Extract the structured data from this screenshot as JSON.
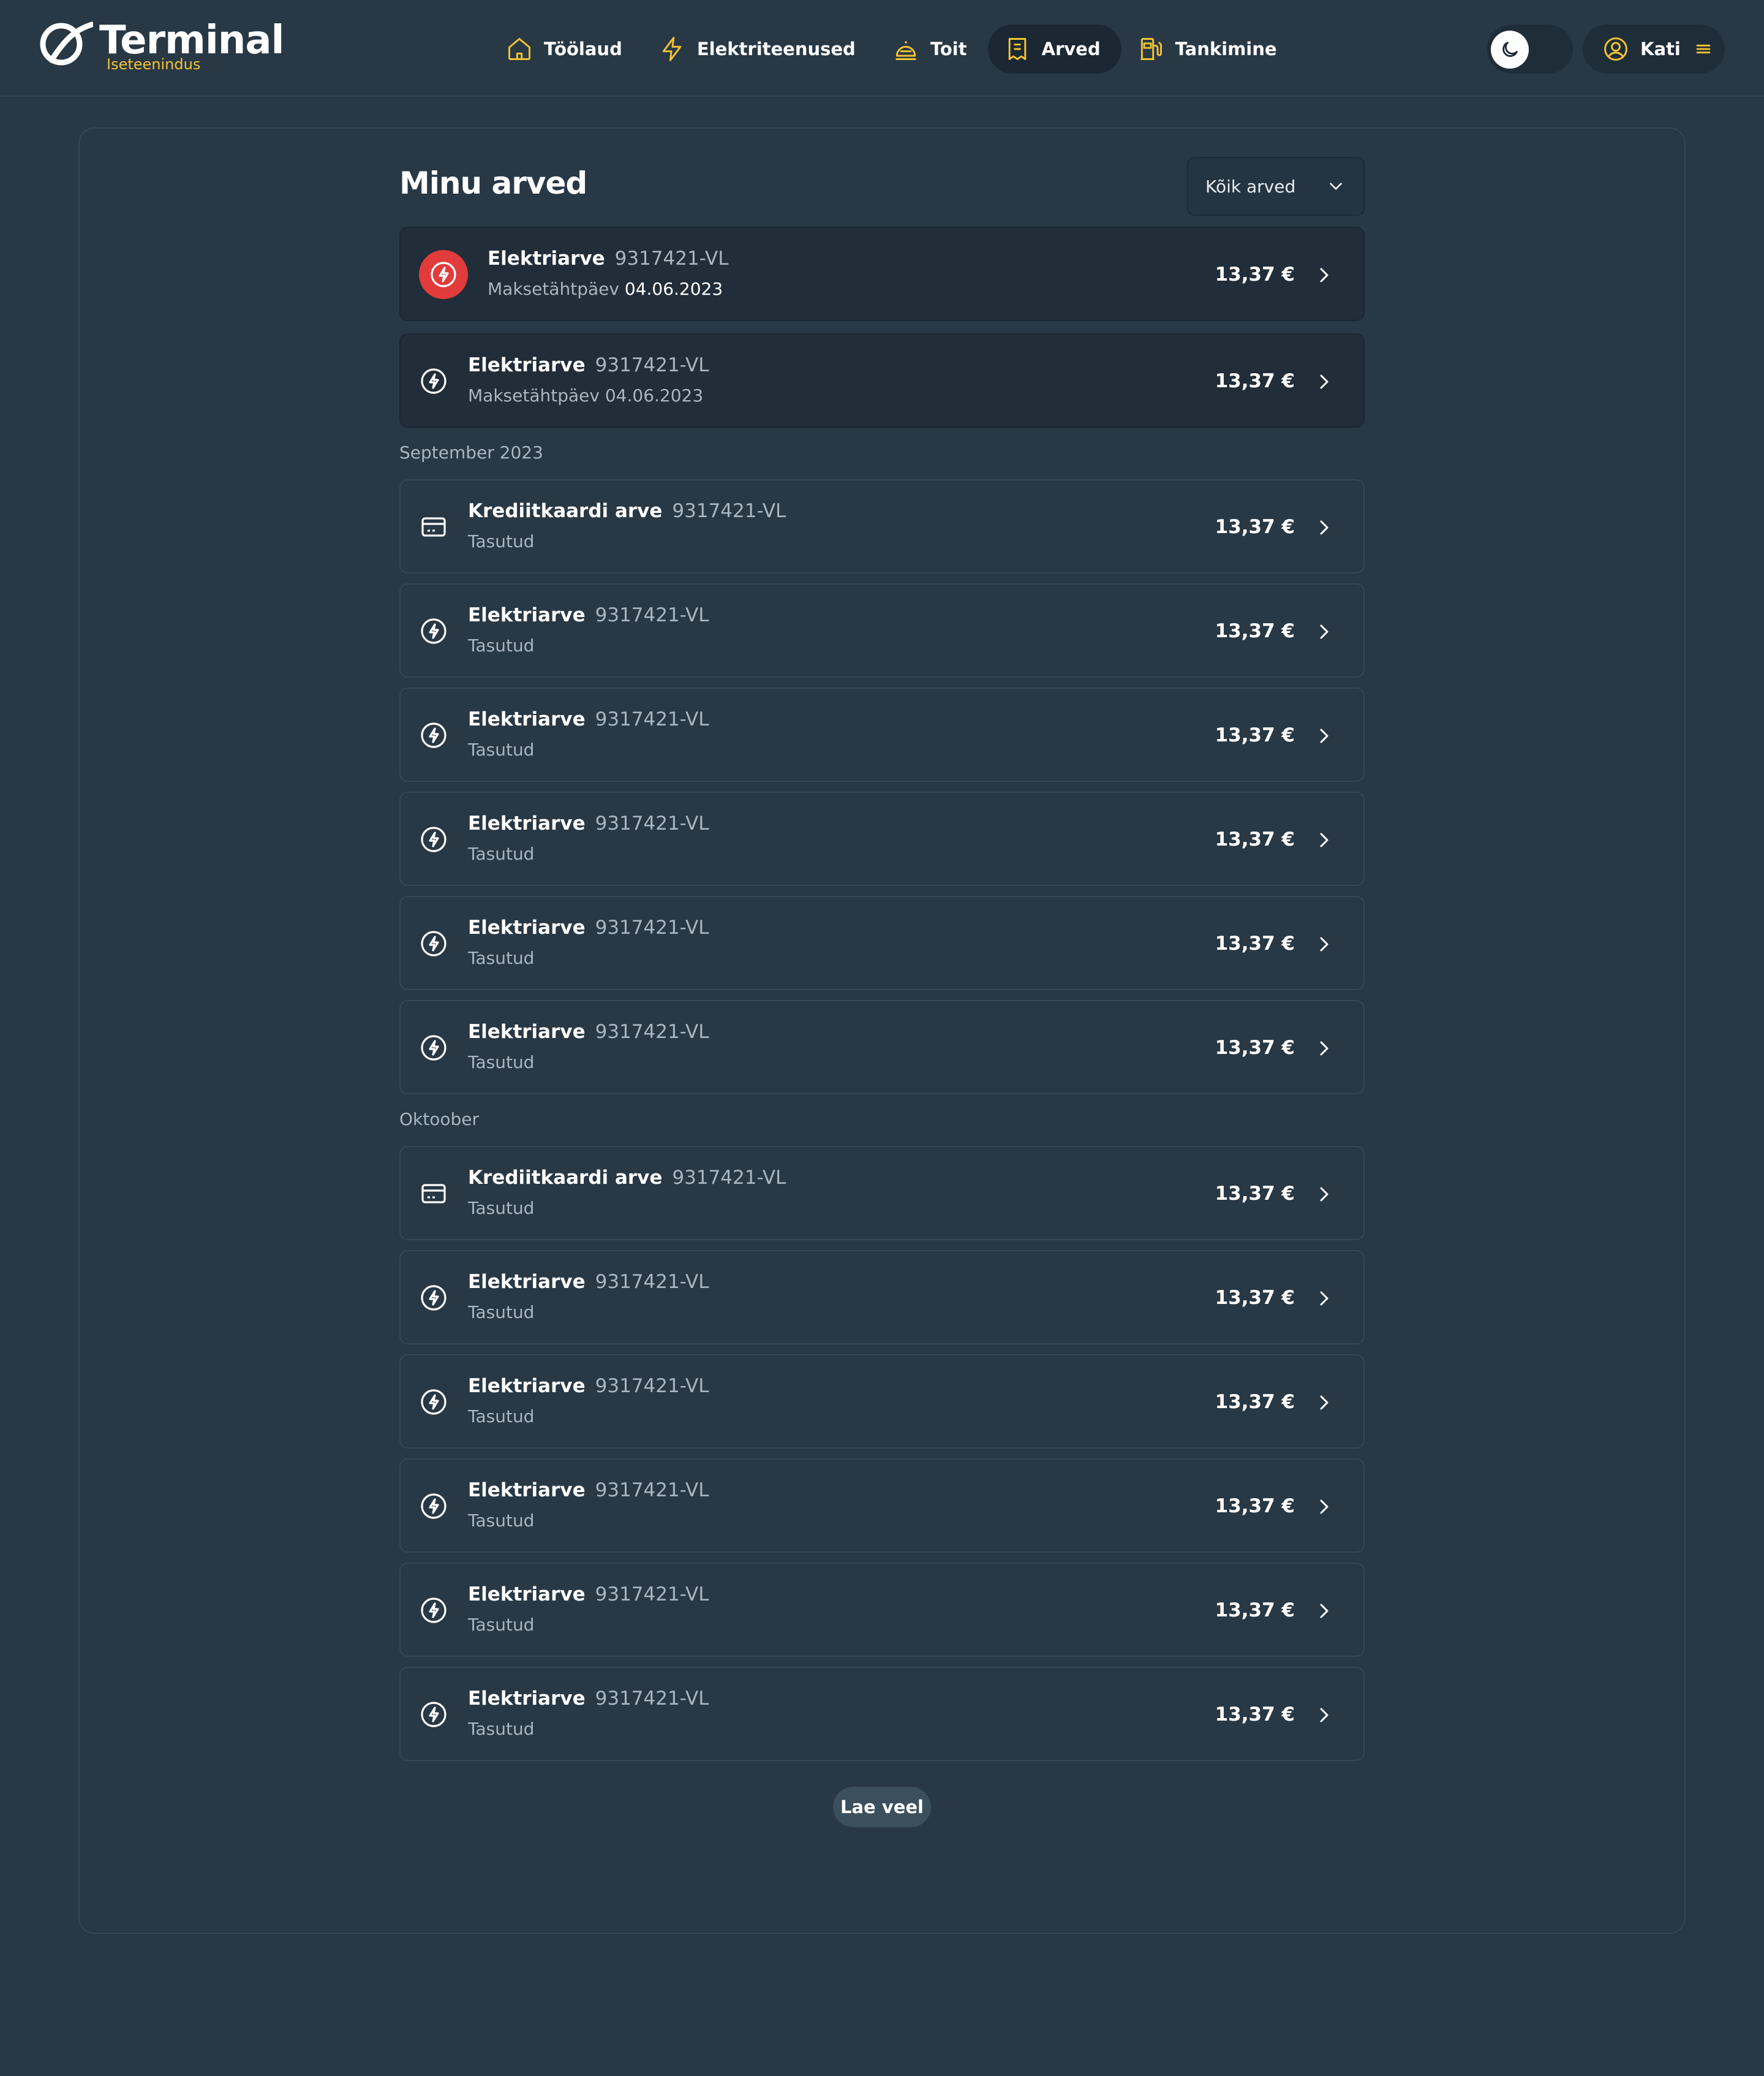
{
  "header": {
    "logo_title": "Terminal",
    "logo_subtitle": "Iseteenindus",
    "nav": [
      {
        "label": "Töölaud",
        "icon": "home-icon",
        "active": false
      },
      {
        "label": "Elektriteenused",
        "icon": "lightning-icon",
        "active": false
      },
      {
        "label": "Toit",
        "icon": "food-bell-icon",
        "active": false
      },
      {
        "label": "Arved",
        "icon": "receipt-icon",
        "active": true
      },
      {
        "label": "Tankimine",
        "icon": "fuel-pump-icon",
        "active": false
      }
    ],
    "theme_toggle_icon": "moon-icon",
    "user": {
      "name": "Kati",
      "avatar_icon": "user-circle-icon",
      "menu_icon": "hamburger-menu-icon"
    }
  },
  "page": {
    "title": "Minu arved",
    "filter_label": "Kõik arved",
    "load_more": "Lae veel"
  },
  "due_invoices": [
    {
      "name": "Elektriarve",
      "number": "9317421-VL",
      "status_label": "Maksetähtpäev",
      "status_date": "04.06.2023",
      "amount": "13,37 €",
      "icon": "lightning-circle-icon",
      "overdue": true
    },
    {
      "name": "Elektriarve",
      "number": "9317421-VL",
      "status_label": "Maksetähtpäev",
      "status_date": "04.06.2023",
      "amount": "13,37 €",
      "icon": "lightning-circle-icon",
      "overdue": false
    }
  ],
  "groups": [
    {
      "label": "September 2023",
      "invoices": [
        {
          "name": "Krediitkaardi arve",
          "number": "9317421-VL",
          "status": "Tasutud",
          "amount": "13,37 €",
          "icon": "credit-card-icon"
        },
        {
          "name": "Elektriarve",
          "number": "9317421-VL",
          "status": "Tasutud",
          "amount": "13,37 €",
          "icon": "lightning-circle-icon"
        },
        {
          "name": "Elektriarve",
          "number": "9317421-VL",
          "status": "Tasutud",
          "amount": "13,37 €",
          "icon": "lightning-circle-icon"
        },
        {
          "name": "Elektriarve",
          "number": "9317421-VL",
          "status": "Tasutud",
          "amount": "13,37 €",
          "icon": "lightning-circle-icon"
        },
        {
          "name": "Elektriarve",
          "number": "9317421-VL",
          "status": "Tasutud",
          "amount": "13,37 €",
          "icon": "lightning-circle-icon"
        },
        {
          "name": "Elektriarve",
          "number": "9317421-VL",
          "status": "Tasutud",
          "amount": "13,37 €",
          "icon": "lightning-circle-icon"
        }
      ]
    },
    {
      "label": "Oktoober",
      "invoices": [
        {
          "name": "Krediitkaardi arve",
          "number": "9317421-VL",
          "status": "Tasutud",
          "amount": "13,37 €",
          "icon": "credit-card-icon"
        },
        {
          "name": "Elektriarve",
          "number": "9317421-VL",
          "status": "Tasutud",
          "amount": "13,37 €",
          "icon": "lightning-circle-icon"
        },
        {
          "name": "Elektriarve",
          "number": "9317421-VL",
          "status": "Tasutud",
          "amount": "13,37 €",
          "icon": "lightning-circle-icon"
        },
        {
          "name": "Elektriarve",
          "number": "9317421-VL",
          "status": "Tasutud",
          "amount": "13,37 €",
          "icon": "lightning-circle-icon"
        },
        {
          "name": "Elektriarve",
          "number": "9317421-VL",
          "status": "Tasutud",
          "amount": "13,37 €",
          "icon": "lightning-circle-icon"
        },
        {
          "name": "Elektriarve",
          "number": "9317421-VL",
          "status": "Tasutud",
          "amount": "13,37 €",
          "icon": "lightning-circle-icon"
        }
      ]
    }
  ],
  "colors": {
    "background": "#283845",
    "accent_yellow": "#f4c430",
    "overdue_red": "#e23b3b",
    "active_nav_bg": "#1b2733"
  }
}
